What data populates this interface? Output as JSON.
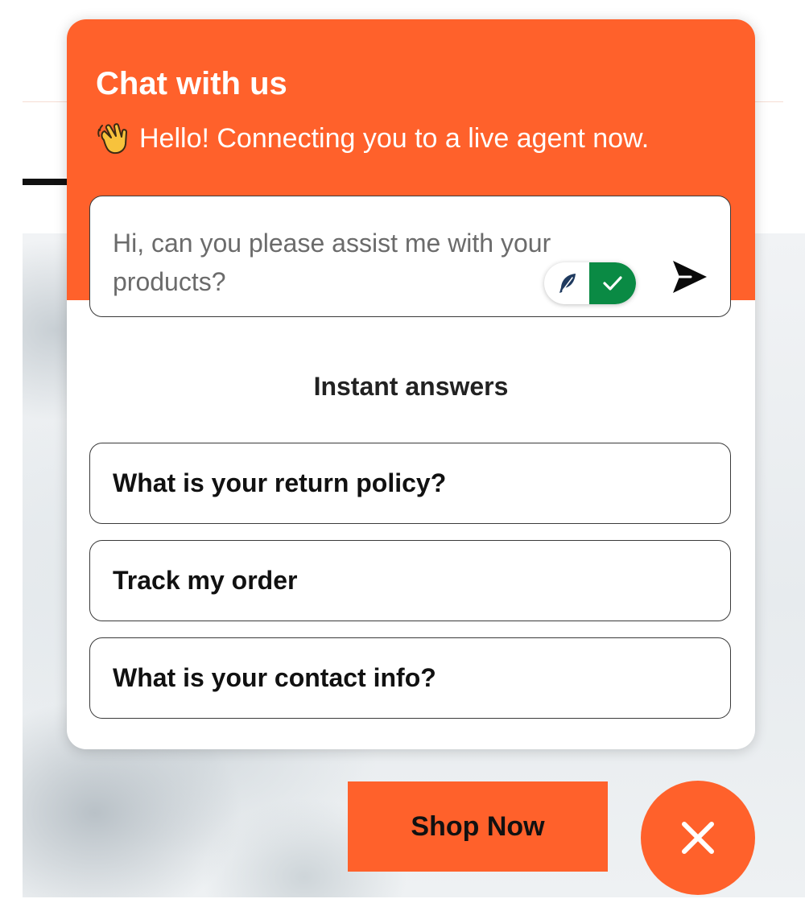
{
  "chat": {
    "title": "Chat with us",
    "subtitle": "Hello! Connecting you to a live agent now.",
    "subtitle_emoji_icon": "waving-hand-icon",
    "composer": {
      "message_text": "Hi, can you please assist me with your products?",
      "ai_toggle_on": true,
      "ai_toggle_off_icon": "feather-icon",
      "ai_toggle_on_icon": "check-icon",
      "send_icon": "send-arrow-icon"
    },
    "instant_answers": {
      "title": "Instant answers",
      "items": [
        {
          "label": "What is your return policy?"
        },
        {
          "label": "Track my order"
        },
        {
          "label": "What is your contact info?"
        }
      ]
    }
  },
  "page": {
    "shop_now_label": "Shop Now",
    "close_chat_icon": "close-icon"
  },
  "colors": {
    "brand_orange": "#ff612b",
    "toggle_green": "#0a8a44",
    "text_dark": "#111111",
    "input_text": "#6b6b6b"
  }
}
